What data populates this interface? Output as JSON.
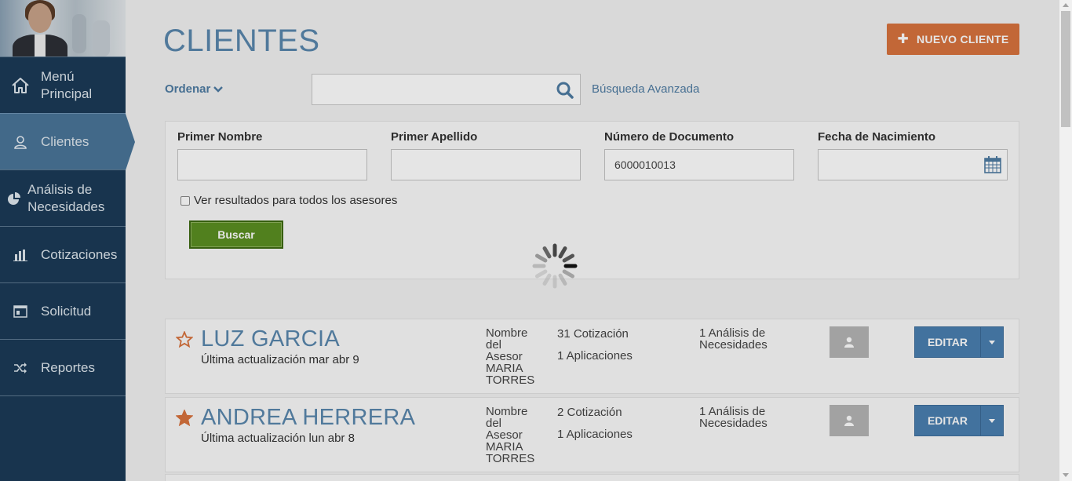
{
  "sidebar": {
    "items": [
      {
        "label": "Menú Principal",
        "icon": "home-icon"
      },
      {
        "label": "Clientes",
        "icon": "user-icon",
        "active": true
      },
      {
        "label": "Análisis de Necesidades",
        "icon": "pie-chart-icon"
      },
      {
        "label": "Cotizaciones",
        "icon": "bar-chart-icon"
      },
      {
        "label": "Solicitud",
        "icon": "form-icon"
      },
      {
        "label": "Reportes",
        "icon": "shuffle-icon"
      }
    ]
  },
  "header": {
    "title": "CLIENTES",
    "new_client_label": "NUEVO CLIENTE"
  },
  "toolbar": {
    "sort_label": "Ordenar",
    "search_value": "",
    "advanced_search_label": "Búsqueda Avanzada"
  },
  "filters": {
    "first_name_label": "Primer Nombre",
    "first_name_value": "",
    "last_name_label": "Primer Apellido",
    "last_name_value": "",
    "document_label": "Número de Documento",
    "document_value": "6000010013",
    "birthdate_label": "Fecha de Nacimiento",
    "birthdate_value": "",
    "all_advisors_label": "Ver resultados para todos los asesores",
    "search_button_label": "Buscar"
  },
  "clients": [
    {
      "name": "LUZ GARCIA",
      "favorite": false,
      "updated": "Última actualización mar abr 9",
      "advisor": "Nombre del Asesor MARIA TORRES",
      "quotes": "31 Cotización",
      "applications": "1 Aplicaciones",
      "analysis": "1 Análisis de Necesidades",
      "edit_label": "EDITAR"
    },
    {
      "name": "ANDREA HERRERA",
      "favorite": true,
      "updated": "Última actualización lun abr 8",
      "advisor": "Nombre del Asesor MARIA TORRES",
      "quotes": "2 Cotización",
      "applications": "1 Aplicaciones",
      "analysis": "1 Análisis de Necesidades",
      "edit_label": "EDITAR"
    }
  ],
  "colors": {
    "sidebar": "#1b3a57",
    "active_nav": "#4a7599",
    "accent_orange": "#d9733e",
    "title_blue": "#5a87ad",
    "search_green": "#5b8f22",
    "edit_blue": "#4a7fb0"
  }
}
